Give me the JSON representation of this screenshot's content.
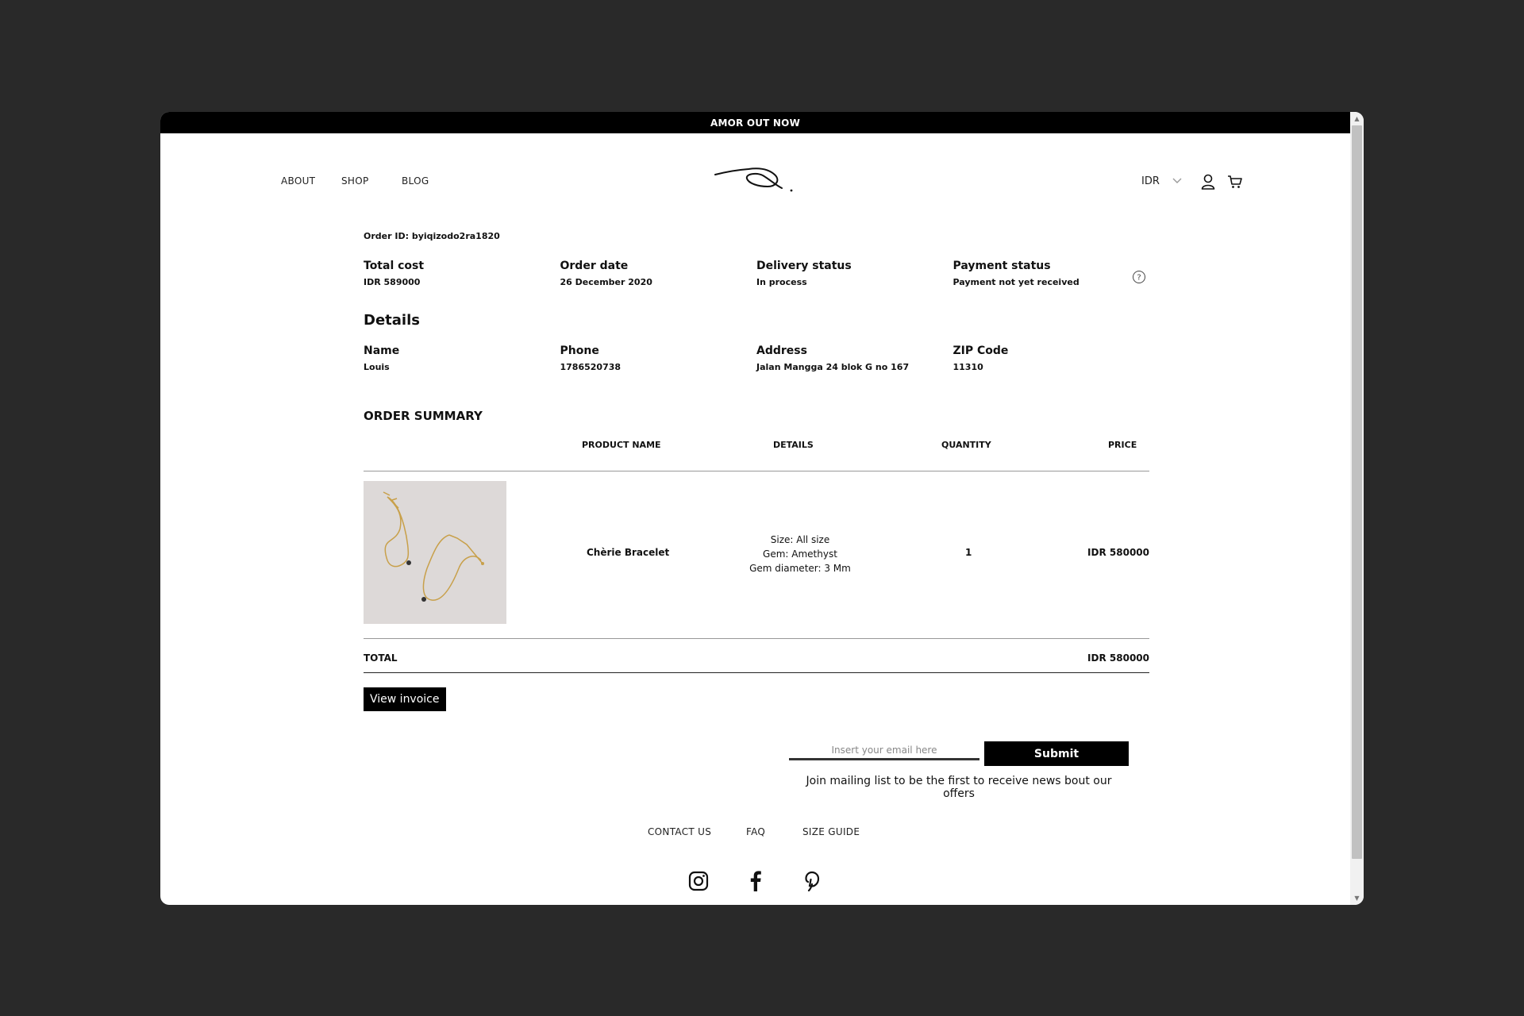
{
  "announcement": "AMOR OUT NOW",
  "nav": {
    "left": [
      "ABOUT",
      "SHOP",
      "BLOG"
    ],
    "currency": "IDR",
    "icons": [
      "user-icon",
      "cart-icon"
    ]
  },
  "order": {
    "id_text": "Order ID: byiqizodo2ra1820",
    "summary": [
      {
        "label": "Total cost",
        "value": "IDR 589000"
      },
      {
        "label": "Order date",
        "value": "26 December 2020"
      },
      {
        "label": "Delivery status",
        "value": "In process"
      },
      {
        "label": "Payment status",
        "value": "Payment not yet received"
      }
    ]
  },
  "details": {
    "heading": "Details",
    "fields": [
      {
        "label": "Name",
        "value": "Louis"
      },
      {
        "label": "Phone",
        "value": "1786520738"
      },
      {
        "label": "Address",
        "value": "Jalan Mangga 24 blok G no 167"
      },
      {
        "label": "ZIP Code",
        "value": "11310"
      }
    ]
  },
  "order_summary": {
    "heading": "ORDER SUMMARY",
    "columns": [
      "PRODUCT NAME",
      "DETAILS",
      "QUANTITY",
      "PRICE"
    ],
    "items": [
      {
        "name": "Chèrie Bracelet",
        "details": [
          "Size: All size",
          "Gem: Amethyst",
          "Gem diameter: 3 Mm"
        ],
        "quantity": "1",
        "price": "IDR 580000"
      }
    ],
    "total_label": "TOTAL",
    "total_value": "IDR 580000"
  },
  "invoice_button": "View invoice",
  "mailing": {
    "placeholder": "Insert your email here",
    "submit": "Submit",
    "note": "Join mailing list to be the first to receive news bout our offers"
  },
  "footer": {
    "links": [
      "CONTACT US",
      "FAQ",
      "SIZE GUIDE"
    ],
    "social": [
      "instagram-icon",
      "facebook-icon",
      "pinterest-icon"
    ]
  }
}
